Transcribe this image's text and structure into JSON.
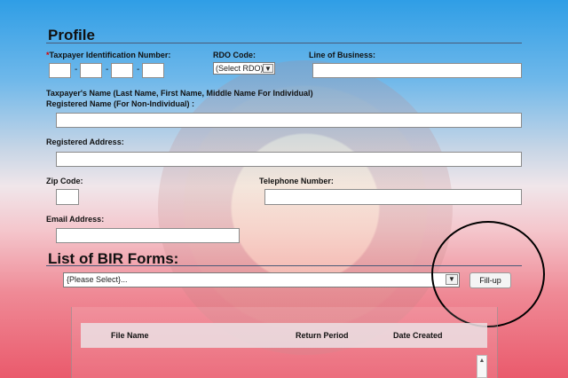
{
  "profile": {
    "title": "Profile",
    "tin_label": "Taxpayer Identification Number:",
    "rdo_label": "RDO Code:",
    "rdo_value": "(Select RDO)",
    "lob_label": "Line of Business:",
    "name_label_1": "Taxpayer's Name (Last Name, First Name, Middle Name For Individual)",
    "name_label_2": "Registered Name (For Non-Individual) :",
    "address_label": "Registered Address:",
    "zip_label": "Zip Code:",
    "phone_label": "Telephone Number:",
    "email_label": "Email Address:"
  },
  "forms": {
    "title": "List of BIR Forms:",
    "select_value": "{Please Select}...",
    "fillup_label": "Fill-up",
    "columns": [
      "File Name",
      "Return Period",
      "Date Created"
    ]
  }
}
